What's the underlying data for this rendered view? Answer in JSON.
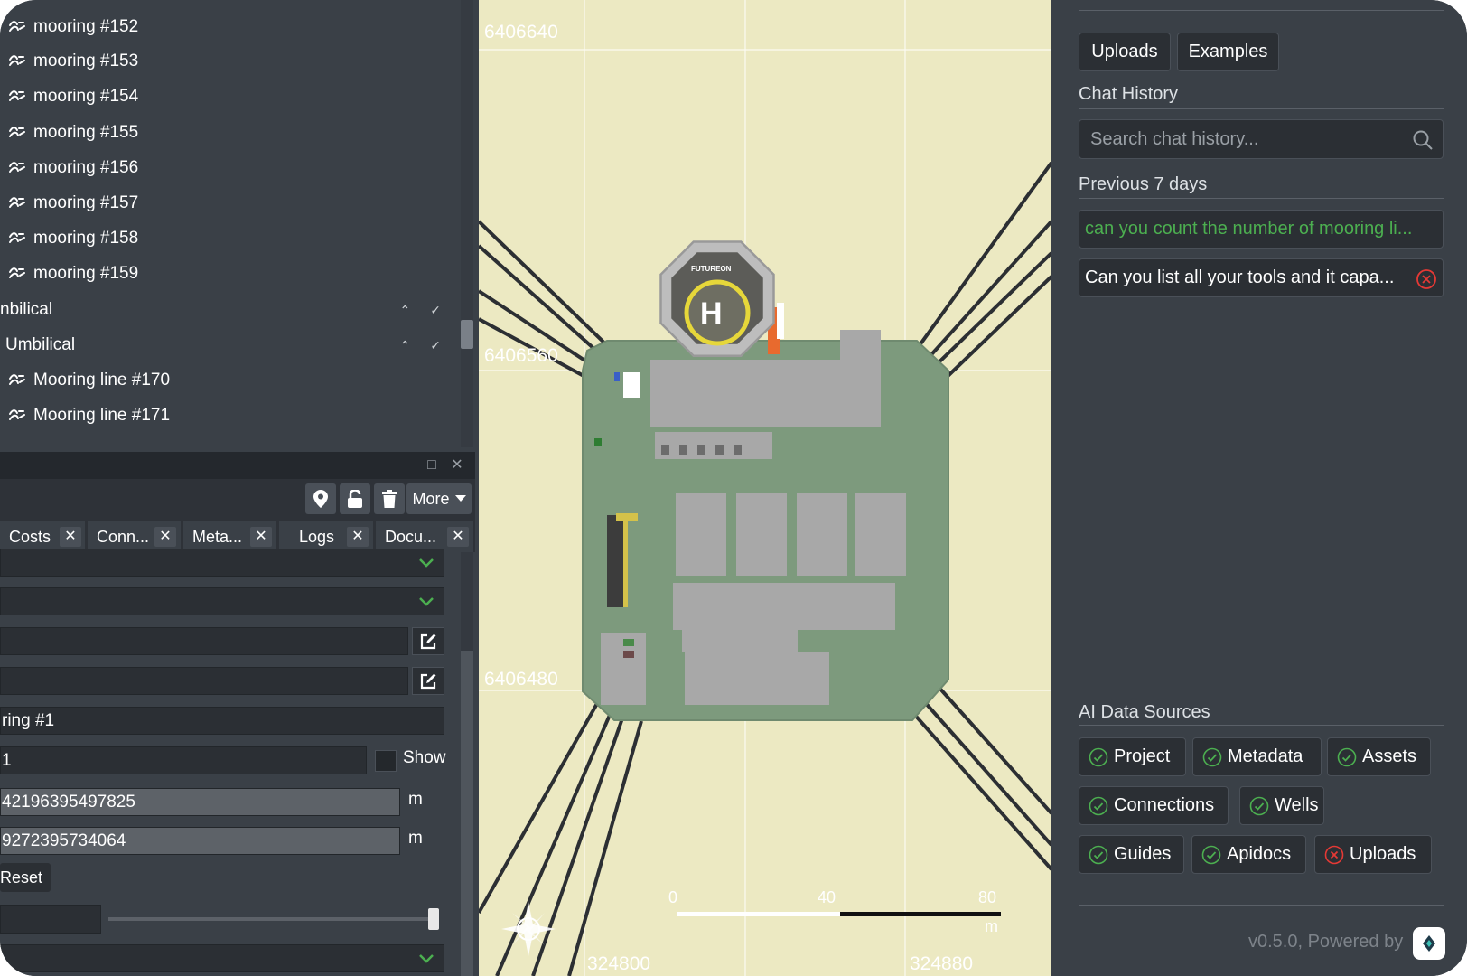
{
  "tree": {
    "items": [
      {
        "label": "mooring #152",
        "icon": "mooring-icon"
      },
      {
        "label": "mooring #153",
        "icon": "mooring-icon"
      },
      {
        "label": "mooring #154",
        "icon": "mooring-icon"
      },
      {
        "label": "mooring #155",
        "icon": "mooring-icon"
      },
      {
        "label": "mooring #156",
        "icon": "mooring-icon"
      },
      {
        "label": "mooring #157",
        "icon": "mooring-icon"
      },
      {
        "label": "mooring #158",
        "icon": "mooring-icon"
      },
      {
        "label": "mooring #159",
        "icon": "mooring-icon"
      }
    ],
    "group1": {
      "label": "nbilical"
    },
    "group2": {
      "label": "Umbilical"
    },
    "lines": [
      {
        "label": "Mooring line #170"
      },
      {
        "label": "Mooring line #171"
      }
    ]
  },
  "toolbar": {
    "more_label": "More"
  },
  "tabs": [
    {
      "label": "Costs"
    },
    {
      "label": "Conn..."
    },
    {
      "label": "Meta..."
    },
    {
      "label": "Logs"
    },
    {
      "label": "Docu..."
    }
  ],
  "form": {
    "name_value": "ring #1",
    "id_value": "1",
    "show_label": "Show",
    "x_value": "42196395497825",
    "y_value": "9272395734064",
    "unit": "m",
    "reset_label": "Reset"
  },
  "map": {
    "coords": {
      "y_top": "6406640",
      "y_mid": "6406560",
      "y_bottom": "6406480",
      "x_left": "324800",
      "x_right": "324880"
    },
    "scale": {
      "zero": "0",
      "mid": "40",
      "end": "80",
      "unit": "m"
    },
    "helipad_letter": "H",
    "helipad_brand": "FUTUREON"
  },
  "right_panel": {
    "uploads_label": "Uploads",
    "examples_label": "Examples",
    "chat_history_heading": "Chat History",
    "search_placeholder": "Search chat history...",
    "previous_heading": "Previous 7 days",
    "chats": [
      {
        "text": "can you count the number of mooring li...",
        "color": "#4caf50"
      },
      {
        "text": "Can you list all your tools and it capa...",
        "color": "#ffffff"
      }
    ],
    "ai_heading": "AI Data Sources",
    "sources": [
      {
        "label": "Project",
        "status": "ok"
      },
      {
        "label": "Metadata",
        "status": "ok"
      },
      {
        "label": "Assets",
        "status": "ok"
      },
      {
        "label": "Connections",
        "status": "ok"
      },
      {
        "label": "Wells",
        "status": "ok"
      },
      {
        "label": "Guides",
        "status": "ok"
      },
      {
        "label": "Apidocs",
        "status": "ok"
      },
      {
        "label": "Uploads",
        "status": "error"
      }
    ],
    "footer": "v0.5.0, Powered by",
    "accent_ok": "#4caf50",
    "accent_error": "#e53935"
  }
}
